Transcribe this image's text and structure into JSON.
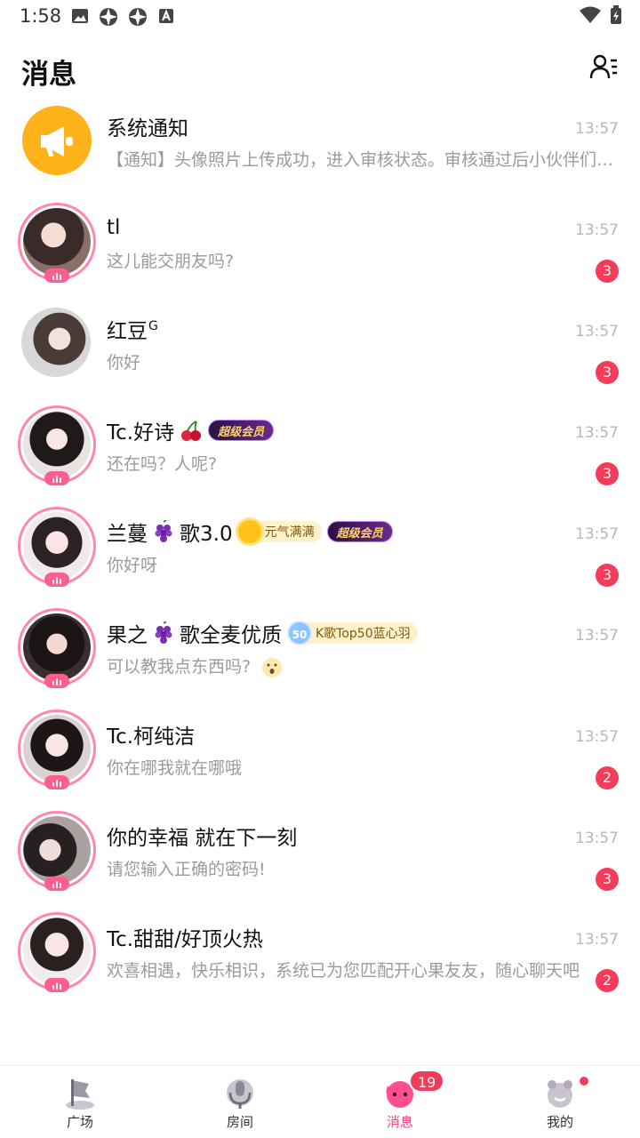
{
  "status_bar": {
    "time": "1:58"
  },
  "header": {
    "title": "消息"
  },
  "messages": [
    {
      "name": "系统通知",
      "time": "13:57",
      "preview": "【通知】头像照片上传成功，进入审核状态。审核通过后小伙伴们将会看到你的新头像",
      "unread": "",
      "avatar": "notice"
    },
    {
      "name": "tl",
      "time": "13:57",
      "preview": "这儿能交朋友吗?",
      "unread": "3",
      "avatar": "live"
    },
    {
      "name": "红豆",
      "name_sup": "G",
      "time": "13:57",
      "preview": "你好",
      "unread": "3",
      "avatar": "plain"
    },
    {
      "name": "Tc.好诗",
      "emoji": "cherry",
      "badges": [
        "超级会员"
      ],
      "time": "13:57",
      "preview": "还在吗？人呢?",
      "unread": "3",
      "avatar": "live"
    },
    {
      "name_parts": [
        "兰蔓",
        "歌3.0"
      ],
      "emoji": "grape",
      "badges": [
        "元气满满",
        "超级会员"
      ],
      "time": "13:57",
      "preview": "你好呀",
      "unread": "3",
      "avatar": "live"
    },
    {
      "name_parts": [
        "果之",
        "歌全麦优质"
      ],
      "emoji": "grape",
      "badges": [
        "K歌Top50蓝心羽"
      ],
      "badge_level": "50",
      "time": "13:57",
      "preview": "可以教我点东西吗?",
      "unread": "",
      "avatar": "live"
    },
    {
      "name": "Tc.柯纯洁",
      "time": "13:57",
      "preview": "你在哪我就在哪哦",
      "unread": "2",
      "avatar": "live"
    },
    {
      "name": "你的幸福 就在下一刻",
      "time": "13:57",
      "preview": "请您输入正确的密码!",
      "unread": "3",
      "avatar": "live"
    },
    {
      "name": "Tc.甜甜/好顶火热",
      "time": "13:57",
      "preview": "欢喜相遇，快乐相识，系统已为您匹配开心果友友，随心聊天吧",
      "unread": "2",
      "avatar": "live"
    }
  ],
  "nav": {
    "items": [
      {
        "label": "广场",
        "icon": "square-flag-icon"
      },
      {
        "label": "房间",
        "icon": "room-mic-icon"
      },
      {
        "label": "消息",
        "icon": "message-face-icon",
        "count": "19",
        "active": true
      },
      {
        "label": "我的",
        "icon": "profile-face-icon"
      }
    ]
  },
  "colors": {
    "accent": "#ff3d7f",
    "badge": "#f33b5a",
    "ring": "#ff86ad",
    "notice": "#ffb21a"
  }
}
